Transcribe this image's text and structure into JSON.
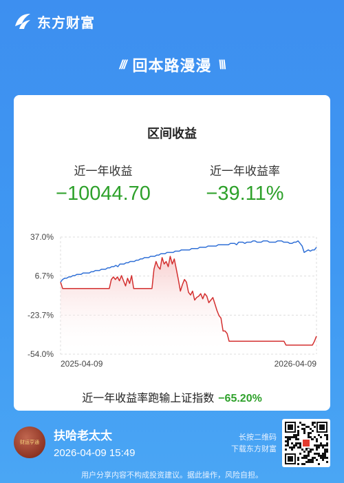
{
  "brand": {
    "name": "东方财富"
  },
  "header": {
    "title": "回本路漫漫",
    "left_deco": "///",
    "right_deco": "\\\\\\"
  },
  "card": {
    "heading": "区间收益",
    "metrics": [
      {
        "label": "近一年收益",
        "value": "−10044.70"
      },
      {
        "label": "近一年收益率",
        "value": "−39.11%"
      }
    ],
    "footer_text": "近一年收益率跑输上证指数",
    "footer_value": "−65.20%"
  },
  "chart_data": {
    "type": "line",
    "y_ticks": [
      "37.0%",
      "6.7%",
      "-23.7%",
      "-54.0%"
    ],
    "ylim": [
      -54.0,
      37.0
    ],
    "x_labels": [
      "2025-04-09",
      "2026-04-09"
    ],
    "grid": true,
    "series": [
      {
        "color": "#d32f2f",
        "values": [
          2,
          -3,
          -3,
          -3,
          -3,
          -3,
          -3,
          -3,
          -3,
          -3,
          -3,
          -3,
          -3,
          -3,
          -3,
          -3,
          -3,
          -3,
          -3,
          -3,
          -3,
          -3,
          -3,
          -3,
          -3,
          4,
          6,
          4,
          6,
          3,
          7,
          3,
          -1,
          5,
          1,
          7,
          -3,
          -3,
          -3,
          -3,
          -3,
          -3,
          -3,
          -3,
          -3,
          -3,
          12,
          18,
          14,
          12,
          21,
          16,
          18,
          14,
          22,
          16,
          20,
          12,
          4,
          -5,
          0,
          4,
          2,
          -6,
          -8,
          -5,
          -12,
          -10,
          -9,
          -7,
          -11,
          -7,
          -9,
          -14,
          -12,
          -10,
          -15,
          -20,
          -24,
          -26,
          -36,
          -36,
          -38,
          -44,
          -44,
          -44,
          -44,
          -44,
          -44,
          -44,
          -44,
          -44,
          -44,
          -44,
          -44,
          -44,
          -44,
          -44,
          -44,
          -44,
          -44,
          -44,
          -44,
          -44,
          -44,
          -44,
          -44,
          -44,
          -44,
          -44,
          -44,
          -47,
          -47,
          -47,
          -47,
          -47,
          -47,
          -47,
          -47,
          -47,
          -47,
          -47,
          -47,
          -47,
          -47,
          -44,
          -40
        ]
      },
      {
        "color": "#2f6fd6",
        "values": [
          2,
          4,
          5,
          5,
          6,
          6,
          7,
          7,
          8,
          8,
          8,
          9,
          9,
          9,
          9,
          10,
          10,
          11,
          11,
          11,
          12,
          12,
          12,
          13,
          13,
          14,
          14,
          15,
          14,
          16,
          16,
          16,
          17,
          17,
          18,
          18,
          18,
          19,
          19,
          20,
          20,
          21,
          21,
          21,
          22,
          22,
          22,
          23,
          23,
          24,
          24,
          24,
          25,
          25,
          25,
          25,
          26,
          26,
          26,
          27,
          27,
          27,
          27,
          27,
          28,
          28,
          28,
          28,
          29,
          29,
          29,
          29,
          30,
          30,
          30,
          30,
          30,
          31,
          31,
          31,
          31,
          31,
          31,
          32,
          32,
          32,
          31,
          33,
          33,
          33,
          32,
          33,
          33,
          33,
          34,
          34,
          33,
          33,
          33,
          34,
          34,
          34,
          33,
          33,
          33,
          33,
          34,
          34,
          34,
          33,
          33,
          33,
          32,
          32,
          33,
          33,
          34,
          32,
          30,
          25,
          26,
          27,
          26,
          27,
          27,
          29
        ]
      }
    ]
  },
  "user": {
    "name": "扶哈老太太",
    "datetime": "2026-04-09 15:49",
    "avatar_text": "财运亨通"
  },
  "qr_hint": {
    "line1": "长按二维码",
    "line2": "下载东方财富"
  },
  "disclaimer": "用户分享内容不构成投资建议。据此操作，风险自担。"
}
